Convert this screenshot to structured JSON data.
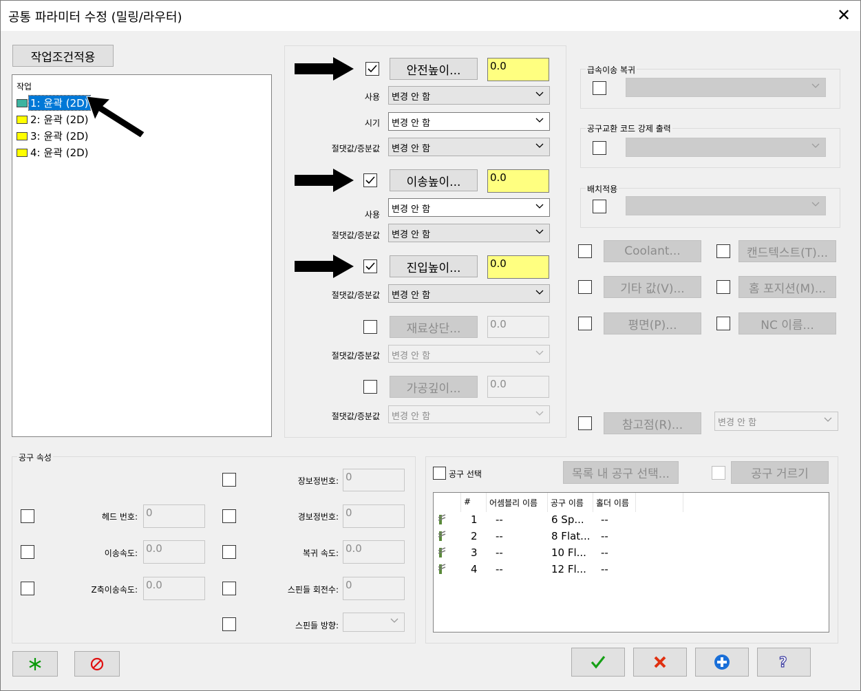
{
  "window": {
    "title": "공통 파라미터 수정 (밀링/라우터)"
  },
  "apply_button": "작업조건적용",
  "tree": {
    "header": "작업",
    "items": [
      {
        "label": "1: 윤곽 (2D)",
        "selected": true
      },
      {
        "label": "2: 윤곽 (2D)",
        "selected": false
      },
      {
        "label": "3: 윤곽 (2D)",
        "selected": false
      },
      {
        "label": "4: 윤곽 (2D)",
        "selected": false
      }
    ]
  },
  "heights": {
    "clearance": {
      "checked": true,
      "button": "안전높이...",
      "value": "0.0"
    },
    "clearance_use": {
      "label": "사용",
      "value": "변경 안 함"
    },
    "clearance_timing": {
      "label": "시기",
      "value": "변경 안 함"
    },
    "clearance_mode": {
      "label": "절댓값/증분값",
      "value": "변경 안 함"
    },
    "retract": {
      "checked": true,
      "button": "이송높이...",
      "value": "0.0"
    },
    "retract_use": {
      "label": "사용",
      "value": "변경 안 함"
    },
    "retract_mode": {
      "label": "절댓값/증분값",
      "value": "변경 안 함"
    },
    "feed": {
      "checked": true,
      "button": "진입높이...",
      "value": "0.0"
    },
    "feed_mode": {
      "label": "절댓값/증분값",
      "value": "변경 안 함"
    },
    "top": {
      "checked": false,
      "button": "재료상단...",
      "value": "0.0"
    },
    "top_mode": {
      "label": "절댓값/증분값",
      "value": "변경 안 함"
    },
    "depth": {
      "checked": false,
      "button": "가공깊이...",
      "value": "0.0"
    },
    "depth_mode": {
      "label": "절댓값/증분값",
      "value": "변경 안 함"
    }
  },
  "right": {
    "rapid_return": "급속이송 복귀",
    "tool_change_code": "공구교환 코드 강제 출력",
    "batch_apply": "배치적용",
    "coolant": "Coolant...",
    "canned_text": "캔드텍스트(T)...",
    "misc_values": "기타 값(V)...",
    "home_position": "홈 포지션(M)...",
    "planes": "평면(P)...",
    "nc_name": "NC 이름...",
    "ref_point": "참고점(R)...",
    "ref_point_value": "변경 안 함"
  },
  "tool_props": {
    "group_label": "공구 속성",
    "length_offset": {
      "label": "장보정번호:",
      "value": "0"
    },
    "head_number": {
      "label": "헤드 번호:",
      "value": "0"
    },
    "dia_offset": {
      "label": "경보정번호:",
      "value": "0"
    },
    "feed_rate": {
      "label": "이송속도:",
      "value": "0.0"
    },
    "retract_rate": {
      "label": "복귀 속도:",
      "value": "0.0"
    },
    "plunge_rate": {
      "label": "Z축이송속도:",
      "value": "0.0"
    },
    "spindle_speed": {
      "label": "스핀들 회전수:",
      "value": "0"
    },
    "spindle_dir": {
      "label": "스핀들 방향:",
      "value": ""
    }
  },
  "tool_select": {
    "checkbox_label": "공구 선택",
    "select_in_list": "목록 내 공구 선택...",
    "tool_filter": "공구 거르기",
    "columns": [
      "#",
      "어셈블리 이름",
      "공구 이름",
      "홀더 이름"
    ],
    "rows": [
      {
        "num": "1",
        "assembly": "--",
        "tool": "6 Sp...",
        "holder": "--"
      },
      {
        "num": "2",
        "assembly": "--",
        "tool": "8 Flat...",
        "holder": "--"
      },
      {
        "num": "3",
        "assembly": "--",
        "tool": "10 Fl...",
        "holder": "--"
      },
      {
        "num": "4",
        "assembly": "--",
        "tool": "12 Fl...",
        "holder": "--"
      }
    ]
  },
  "colors": {
    "accent": "#0078d7",
    "highlight_field": "#ffff80"
  },
  "icons": {
    "footer": [
      "asterisk-icon",
      "no-entry-icon",
      "checkmark-icon",
      "x-icon",
      "plus-circle-icon",
      "help-icon"
    ]
  }
}
